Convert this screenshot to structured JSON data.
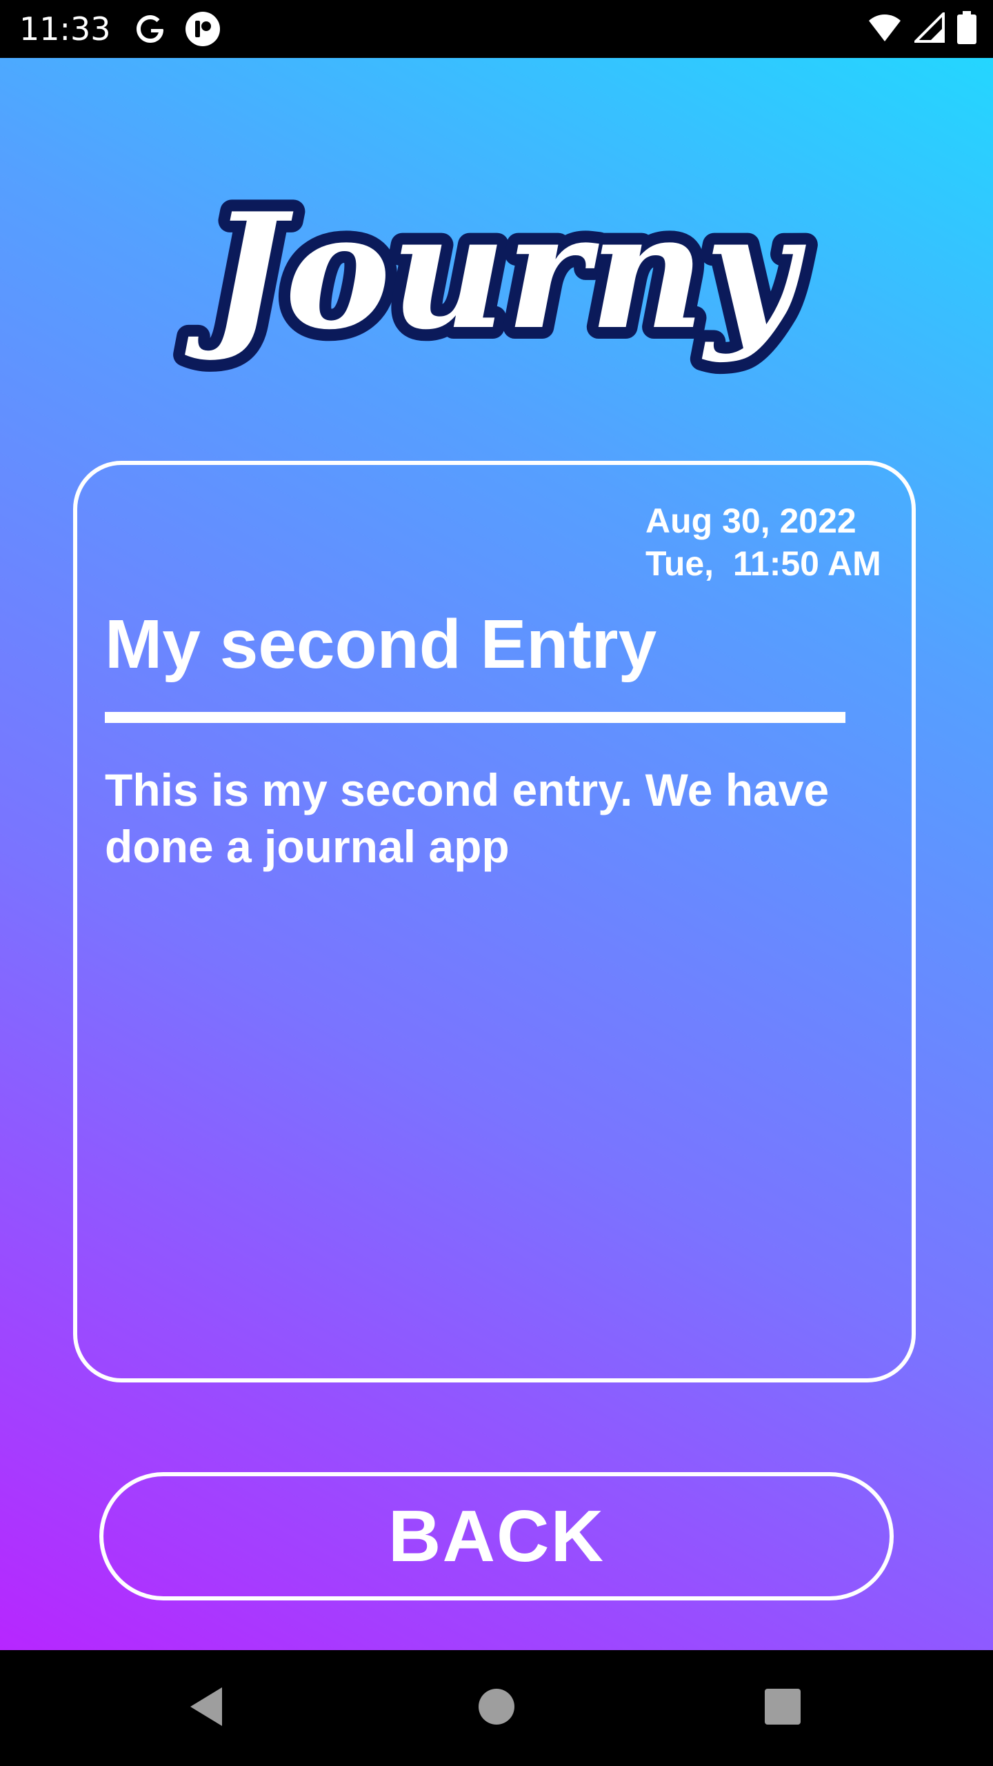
{
  "status_bar": {
    "time": "11:33",
    "left_icons": [
      "google-g-icon",
      "app-notification-icon"
    ],
    "right_icons": [
      "wifi-icon",
      "cellular-signal-icon",
      "battery-icon"
    ]
  },
  "app": {
    "logo_text": "Journy",
    "entry": {
      "date": "Aug 30, 2022",
      "day_time": "Tue,  11:50 AM",
      "title": "My second Entry",
      "body": "This is my second entry. We have done a journal app"
    },
    "back_button_label": "BACK"
  },
  "nav_bar": {
    "buttons": [
      "back-triangle-icon",
      "home-circle-icon",
      "recents-square-icon"
    ]
  },
  "colors": {
    "gradient_top_right": "#24d6ff",
    "gradient_bottom_left": "#b726ff",
    "logo_outline": "#0b1a5a",
    "foreground": "#ffffff"
  }
}
